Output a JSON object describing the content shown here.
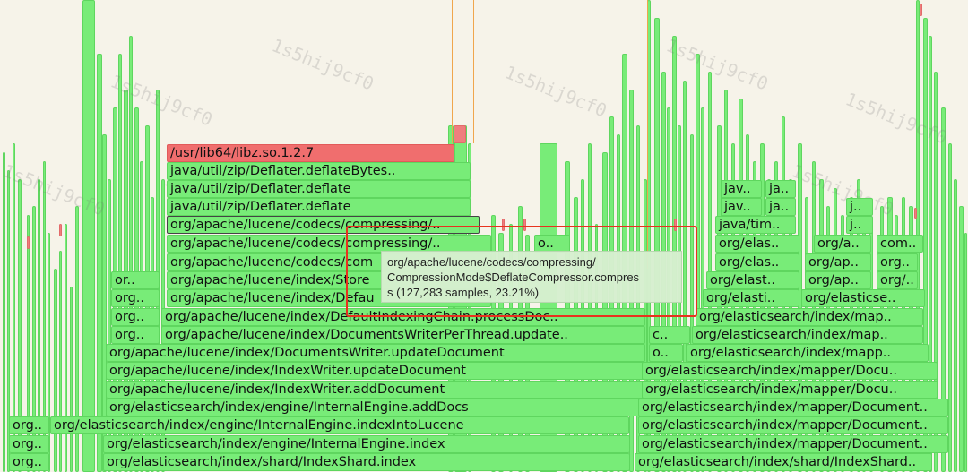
{
  "watermark": "1s5hij9cf0",
  "colors": {
    "background": "#f6f3e9",
    "frame": "#78ec78",
    "frame_hot": "#f06e6e",
    "highlight_box": "#e8321e"
  },
  "frames": [
    {
      "label": "/usr/lib64/libz.so.1.2.7",
      "hot": true
    },
    {
      "label": "java/util/zip/Deflater.deflateBytes.."
    },
    {
      "label": "java/util/zip/Deflater.deflate"
    },
    {
      "label": "java/util/zip/Deflater.deflate"
    },
    {
      "label": "org/apache/lucene/codecs/compressing/..",
      "selected": true
    },
    {
      "label": "org/apache/lucene/codecs/compressing/.."
    },
    {
      "label": "org/apache/lucene/codecs/com"
    },
    {
      "label": "org/apache/lucene/index/Store"
    },
    {
      "label": "org/apache/lucene/index/Defau"
    },
    {
      "label": "org/apache/lucene/index/DefaultIndexingChain.processDoc.."
    },
    {
      "label": "org/apache/lucene/index/DocumentsWriterPerThread.update.."
    },
    {
      "label": "org/apache/lucene/index/DocumentsWriter.updateDocument"
    },
    {
      "label": "org/apache/lucene/index/IndexWriter.updateDocument"
    },
    {
      "label": "org/apache/lucene/index/IndexWriter.addDocument"
    },
    {
      "label": "org/elasticsearch/index/engine/InternalEngine.addDocs"
    },
    {
      "label": "org/elasticsearch/index/engine/InternalEngine.indexIntoLucene"
    },
    {
      "label": "org/elasticsearch/index/engine/InternalEngine.index"
    },
    {
      "label": "org/elasticsearch/index/shard/IndexShard.index"
    },
    {
      "label": "org.."
    },
    {
      "label": "org.."
    },
    {
      "label": "org.."
    },
    {
      "label": "or.."
    },
    {
      "label": "org.."
    },
    {
      "label": "org.."
    },
    {
      "label": "org.."
    },
    {
      "label": "o.."
    },
    {
      "label": "jav.."
    },
    {
      "label": "ja.."
    },
    {
      "label": "jav.."
    },
    {
      "label": "ja.."
    },
    {
      "label": "java/tim.."
    },
    {
      "label": "j.."
    },
    {
      "label": "j.."
    },
    {
      "label": "org/elas.."
    },
    {
      "label": "org/a.."
    },
    {
      "label": "com.."
    },
    {
      "label": "org/elas.."
    },
    {
      "label": "org/ap.."
    },
    {
      "label": "org.."
    },
    {
      "label": "org/elast.."
    },
    {
      "label": "org/ap.."
    },
    {
      "label": "org/.."
    },
    {
      "label": "org/elasti.."
    },
    {
      "label": "org/elasticse.."
    },
    {
      "label": "org/elasticsearch/index/map.."
    },
    {
      "label": "c.."
    },
    {
      "label": "org/elasticsearch/index/map.."
    },
    {
      "label": "o.."
    },
    {
      "label": "org/elasticsearch/index/mapp.."
    },
    {
      "label": "org/elasticsearch/index/mapper/Docu.."
    },
    {
      "label": "org/elasticsearch/index/mapper/Docu.."
    },
    {
      "label": "org/elasticsearch/index/mapper/Document.."
    },
    {
      "label": "org/elasticsearch/index/mapper/Document.."
    },
    {
      "label": "org/elasticsearch/index/mapper/Document.."
    },
    {
      "label": "org/elasticsearch/index/shard/IndexShard.."
    }
  ],
  "tooltip": {
    "line1": "org/apache/lucene/codecs/compressing/",
    "line2": "CompressionMode$DeflateCompressor.compres",
    "line3": "s (127,283 samples, 23.21%)"
  }
}
